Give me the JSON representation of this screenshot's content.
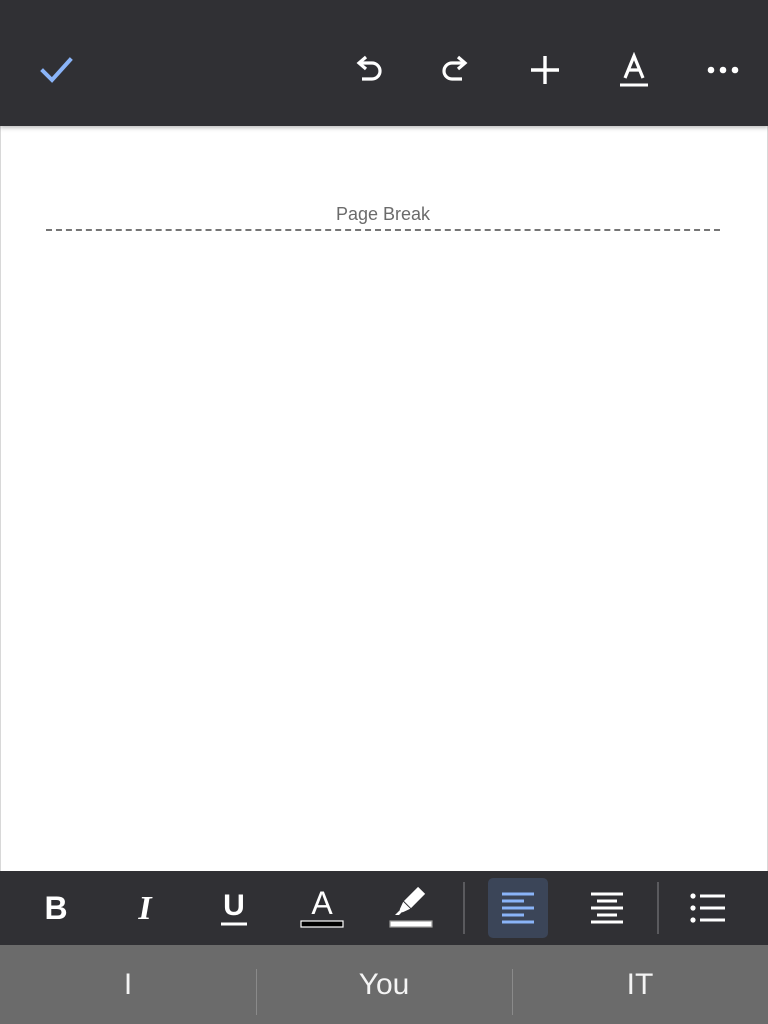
{
  "colors": {
    "toolbar_bg": "#303034",
    "accent": "#8ab4f8",
    "icon": "#ffffff",
    "active_bg": "#3b4558",
    "suggestion_bar_bg": "#6b6b6b"
  },
  "top_toolbar": {
    "icons": [
      "checkmark-icon",
      "undo-icon",
      "redo-icon",
      "plus-icon",
      "text-format-icon",
      "more-icon"
    ]
  },
  "document": {
    "page_break_label": "Page Break"
  },
  "format_toolbar": {
    "bold_label": "B",
    "italic_label": "I",
    "underline_label": "U",
    "text_color_label": "A",
    "text_color_value": "#000000",
    "highlight_color_value": "#ffffff",
    "alignment_selected": "left"
  },
  "suggestions": [
    "I",
    "You",
    "IT"
  ]
}
